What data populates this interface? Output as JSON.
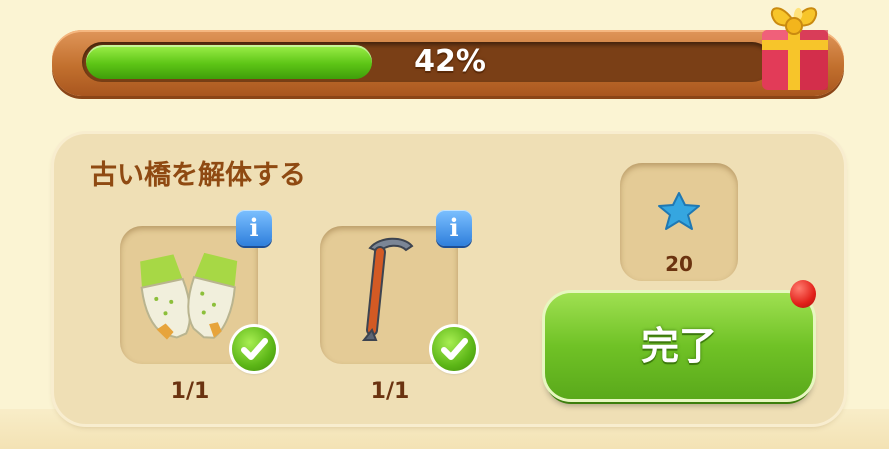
{
  "progress": {
    "value": 0.42,
    "label": "42%"
  },
  "colors": {
    "fill": "#5dc516",
    "frame": "#c2702e",
    "card": "#efdfb5",
    "title": "#8f4a12"
  },
  "task": {
    "title": "古い橋を解体する",
    "requirements": [
      {
        "item": "gloves-icon",
        "count": "1/1",
        "info": "i"
      },
      {
        "item": "crowbar-icon",
        "count": "1/1",
        "info": "i"
      }
    ],
    "reward": {
      "item": "blue-star-icon",
      "count": "20"
    },
    "complete_label": "完了"
  }
}
